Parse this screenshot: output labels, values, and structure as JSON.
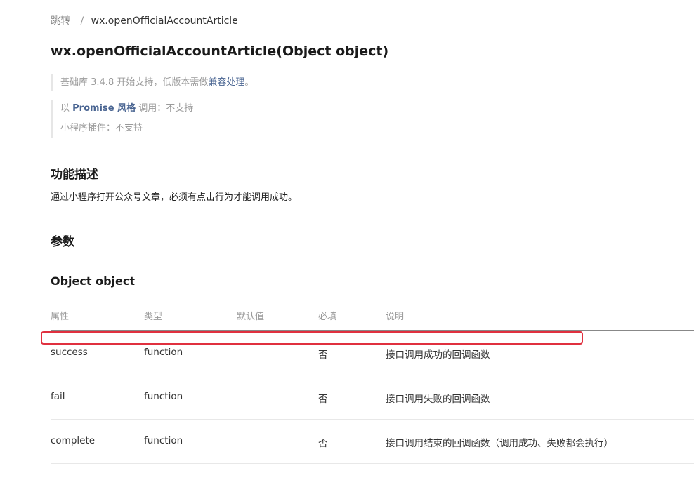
{
  "breadcrumb": {
    "parent": "跳转",
    "separator": "/",
    "current": "wx.openOfficialAccountArticle"
  },
  "title": "wx.openOfficialAccountArticle(Object object)",
  "support_note": {
    "prefix": "基础库 3.4.8 开始支持，低版本需做",
    "link": "兼容处理",
    "suffix": "。"
  },
  "compat_note": {
    "promise_prefix": "以 ",
    "promise_strong": "Promise 风格",
    "promise_label": " 调用：",
    "promise_value": "不支持",
    "plugin_label": "小程序插件：",
    "plugin_value": "不支持"
  },
  "section_desc": {
    "heading": "功能描述",
    "text": "通过小程序打开公众号文章，必须有点击行为才能调用成功。"
  },
  "section_params": {
    "heading": "参数",
    "object_heading": "Object object"
  },
  "table": {
    "headers": [
      "属性",
      "类型",
      "默认值",
      "必填",
      "说明"
    ],
    "rows": [
      {
        "name": "success",
        "type": "function",
        "default": "",
        "required": "否",
        "desc": "接口调用成功的回调函数"
      },
      {
        "name": "fail",
        "type": "function",
        "default": "",
        "required": "否",
        "desc": "接口调用失败的回调函数"
      },
      {
        "name": "complete",
        "type": "function",
        "default": "",
        "required": "否",
        "desc": "接口调用结束的回调函数（调用成功、失败都会执行）"
      }
    ]
  },
  "colors": {
    "link": "#4a6592",
    "highlight_border": "#e0303f"
  }
}
